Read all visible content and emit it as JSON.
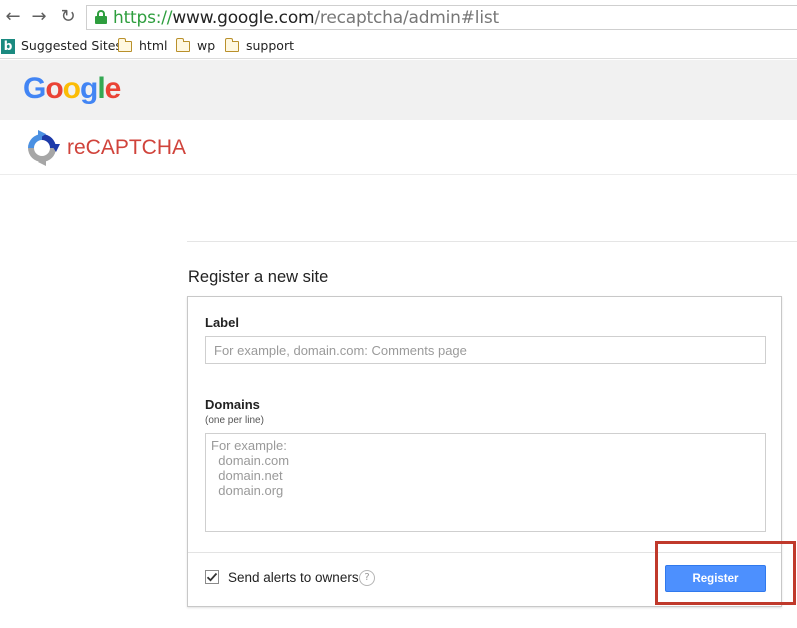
{
  "browser": {
    "url_scheme": "https://",
    "url_host": "www.google.com",
    "url_path": "/recaptcha/admin#list",
    "back_icon": "arrow-left-icon",
    "forward_icon": "arrow-right-icon",
    "reload_icon": "reload-icon",
    "bookmarks": [
      {
        "label": "Suggested Sites",
        "icon": "bing-icon"
      },
      {
        "label": "html",
        "icon": "folder-icon"
      },
      {
        "label": "wp",
        "icon": "folder-icon"
      },
      {
        "label": "support",
        "icon": "folder-icon"
      }
    ]
  },
  "header": {
    "google_logo": [
      "G",
      "o",
      "o",
      "g",
      "l",
      "e"
    ],
    "product_title": "reCAPTCHA"
  },
  "form": {
    "section_title": "Register a new site",
    "label_field": {
      "label": "Label",
      "placeholder": "For example, domain.com: Comments page",
      "value": ""
    },
    "domains_field": {
      "label": "Domains",
      "sublabel": "(one per line)",
      "placeholder": "For example:\n  domain.com\n  domain.net\n  domain.org",
      "value": ""
    },
    "alerts_checkbox": {
      "label": "Send alerts to owners",
      "checked": true,
      "help_icon": "question-icon"
    },
    "register_button": "Register"
  },
  "colors": {
    "accent_blue": "#4d90fe",
    "recaptcha_red": "#d0433b",
    "secure_green": "#2e9e3e",
    "highlight_red": "#c0392b"
  }
}
